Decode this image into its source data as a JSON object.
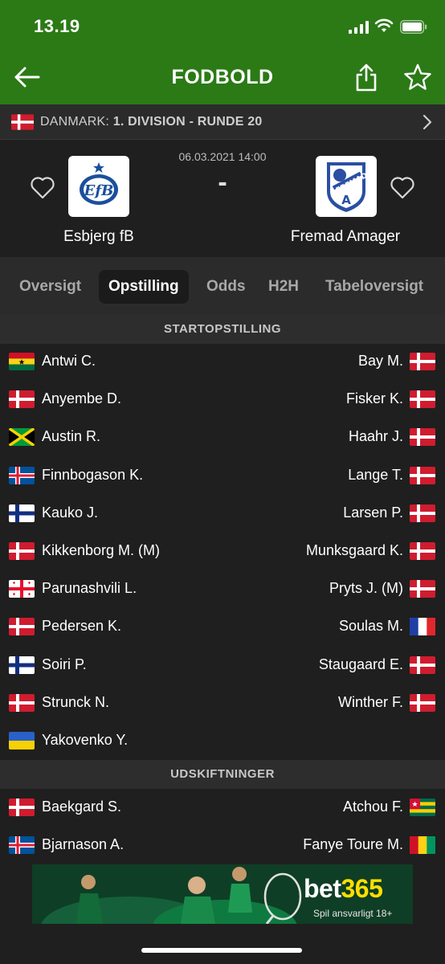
{
  "status": {
    "time": "13.19"
  },
  "nav": {
    "title": "FODBOLD"
  },
  "league": {
    "country": "DANMARK:",
    "competition": "1. DIVISION - RUNDE 20"
  },
  "match": {
    "datetime": "06.03.2021 14:00",
    "score": "-",
    "home_team": "Esbjerg fB",
    "away_team": "Fremad Amager"
  },
  "tabs": [
    {
      "label": "Oversigt",
      "active": false
    },
    {
      "label": "Opstilling",
      "active": true
    },
    {
      "label": "Odds",
      "active": false
    },
    {
      "label": "H2H",
      "active": false
    },
    {
      "label": "Tabeloversigt",
      "active": false
    }
  ],
  "sections": {
    "starting": "STARTOPSTILLING",
    "subs": "UDSKIFTNINGER"
  },
  "starting_lineup": [
    {
      "home": "Antwi C.",
      "home_flag": "ghana-flag",
      "away": "Bay M.",
      "away_flag": "denmark-flag"
    },
    {
      "home": "Anyembe D.",
      "home_flag": "denmark-flag",
      "away": "Fisker K.",
      "away_flag": "denmark-flag"
    },
    {
      "home": "Austin R.",
      "home_flag": "jamaica-flag",
      "away": "Haahr J.",
      "away_flag": "denmark-flag"
    },
    {
      "home": "Finnbogason K.",
      "home_flag": "iceland-flag",
      "away": "Lange T.",
      "away_flag": "denmark-flag"
    },
    {
      "home": "Kauko J.",
      "home_flag": "finland-flag",
      "away": "Larsen P.",
      "away_flag": "denmark-flag"
    },
    {
      "home": "Kikkenborg M. (M)",
      "home_flag": "denmark-flag",
      "away": "Munksgaard K.",
      "away_flag": "denmark-flag"
    },
    {
      "home": "Parunashvili L.",
      "home_flag": "georgia-flag",
      "away": "Pryts J. (M)",
      "away_flag": "denmark-flag"
    },
    {
      "home": "Pedersen K.",
      "home_flag": "denmark-flag",
      "away": "Soulas M.",
      "away_flag": "france-flag"
    },
    {
      "home": "Soiri P.",
      "home_flag": "finland-flag",
      "away": "Staugaard E.",
      "away_flag": "denmark-flag"
    },
    {
      "home": "Strunck N.",
      "home_flag": "denmark-flag",
      "away": "Winther F.",
      "away_flag": "denmark-flag"
    },
    {
      "home": "Yakovenko Y.",
      "home_flag": "ukraine-flag",
      "away": "",
      "away_flag": ""
    }
  ],
  "substitutes": [
    {
      "home": "Baekgard S.",
      "home_flag": "denmark-flag",
      "away": "Atchou F.",
      "away_flag": "togo-flag"
    },
    {
      "home": "Bjarnason A.",
      "home_flag": "iceland-flag",
      "away": "Fanye Toure M.",
      "away_flag": "guinea-flag"
    }
  ],
  "ad": {
    "brand_main": "bet",
    "brand_num": "365",
    "tagline": "Spil ansvarligt  18+"
  },
  "colors": {
    "header_green": "#2b7a16",
    "background": "#1f1f1f",
    "bet365_yellow": "#ffde00"
  }
}
